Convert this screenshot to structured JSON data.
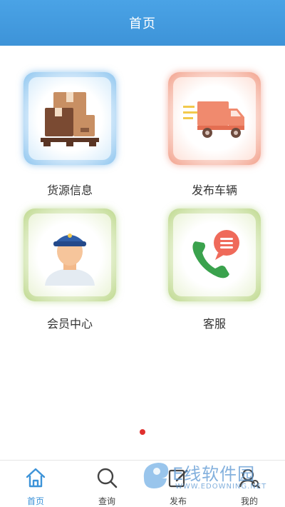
{
  "header": {
    "title": "首页"
  },
  "tiles": [
    {
      "label": "货源信息",
      "icon": "cargo-boxes-icon",
      "color": "#4fa0e1"
    },
    {
      "label": "发布车辆",
      "icon": "truck-icon",
      "color": "#ec785f"
    },
    {
      "label": "会员中心",
      "icon": "member-avatar-icon",
      "color": "#a0c864"
    },
    {
      "label": "客服",
      "icon": "phone-chat-icon",
      "color": "#a0c864"
    }
  ],
  "pager": {
    "active_color": "#e0302e"
  },
  "tabbar": {
    "items": [
      {
        "label": "首页",
        "icon": "home-icon",
        "active": true
      },
      {
        "label": "查询",
        "icon": "search-icon",
        "active": false
      },
      {
        "label": "发布",
        "icon": "publish-icon",
        "active": false
      },
      {
        "label": "我的",
        "icon": "profile-icon",
        "active": false
      }
    ],
    "active_color": "#3d93d8"
  },
  "watermark": {
    "main": "E线软件园",
    "sub": "WWW.EDOWNING.NET"
  }
}
